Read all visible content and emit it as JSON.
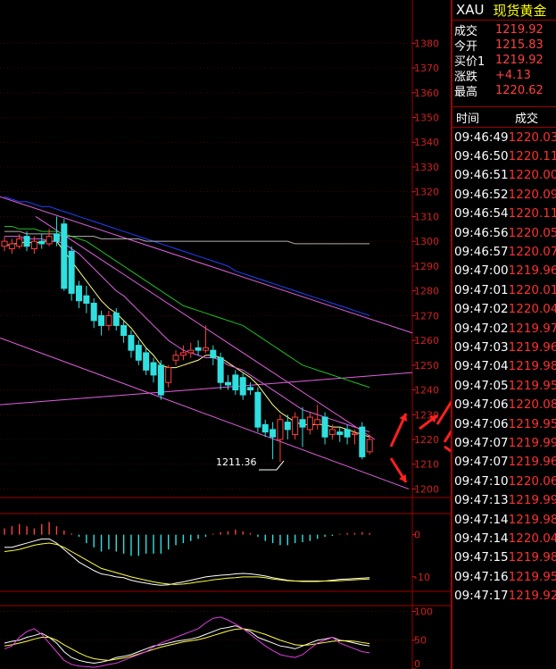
{
  "header": {
    "symbol": "XAU",
    "name": "现货黄金"
  },
  "quote": [
    {
      "label": "成交",
      "value": "1219.92"
    },
    {
      "label": "今开",
      "value": "1215.83"
    },
    {
      "label": "买价1",
      "value": "1219.92"
    },
    {
      "label": "涨跌",
      "value": "+4.13"
    },
    {
      "label": "最高",
      "value": "1220.62"
    }
  ],
  "trades_header": {
    "time": "时间",
    "price": "成交"
  },
  "trades": [
    {
      "time": "09:46:49",
      "price": "1220.03"
    },
    {
      "time": "09:46:50",
      "price": "1220.11"
    },
    {
      "time": "09:46:51",
      "price": "1220.00"
    },
    {
      "time": "09:46:52",
      "price": "1220.09"
    },
    {
      "time": "09:46:54",
      "price": "1220.11"
    },
    {
      "time": "09:46:56",
      "price": "1220.05"
    },
    {
      "time": "09:46:57",
      "price": "1220.07"
    },
    {
      "time": "09:47:00",
      "price": "1219.96"
    },
    {
      "time": "09:47:01",
      "price": "1220.01"
    },
    {
      "time": "09:47:02",
      "price": "1220.04"
    },
    {
      "time": "09:47:02",
      "price": "1219.97"
    },
    {
      "time": "09:47:03",
      "price": "1219.96"
    },
    {
      "time": "09:47:04",
      "price": "1219.98"
    },
    {
      "time": "09:47:05",
      "price": "1219.95"
    },
    {
      "time": "09:47:06",
      "price": "1220.08"
    },
    {
      "time": "09:47:06",
      "price": "1219.95"
    },
    {
      "time": "09:47:07",
      "price": "1219.99"
    },
    {
      "time": "09:47:07",
      "price": "1219.96"
    },
    {
      "time": "09:47:10",
      "price": "1220.06"
    },
    {
      "time": "09:47:13",
      "price": "1219.99"
    },
    {
      "time": "09:47:14",
      "price": "1219.98"
    },
    {
      "time": "09:47:14",
      "price": "1220.04"
    },
    {
      "time": "09:47:15",
      "price": "1219.98"
    },
    {
      "time": "09:47:16",
      "price": "1219.95"
    },
    {
      "time": "09:47:17",
      "price": "1219.92"
    }
  ],
  "chart_data": [
    {
      "type": "candlestick",
      "price_axis_ticks": [
        1380,
        1370,
        1360,
        1350,
        1340,
        1330,
        1320,
        1310,
        1300,
        1290,
        1280,
        1270,
        1260,
        1250,
        1240,
        1230,
        1220,
        1210,
        1200
      ],
      "ylim": [
        1198,
        1383
      ],
      "annotations": [
        {
          "text": "1211.36",
          "value": 1211.36
        }
      ],
      "candles": [
        {
          "o": 1298,
          "c": 1300,
          "h": 1302,
          "l": 1296
        },
        {
          "o": 1297,
          "c": 1299,
          "h": 1301,
          "l": 1295
        },
        {
          "o": 1298,
          "c": 1301,
          "h": 1303,
          "l": 1297
        },
        {
          "o": 1302,
          "c": 1298,
          "h": 1304,
          "l": 1296
        },
        {
          "o": 1297,
          "c": 1300,
          "h": 1302,
          "l": 1295
        },
        {
          "o": 1300,
          "c": 1299,
          "h": 1303,
          "l": 1297
        },
        {
          "o": 1299,
          "c": 1302,
          "h": 1305,
          "l": 1298
        },
        {
          "o": 1303,
          "c": 1300,
          "h": 1310,
          "l": 1298
        },
        {
          "o": 1307,
          "c": 1281,
          "h": 1309,
          "l": 1280
        },
        {
          "o": 1296,
          "c": 1279,
          "h": 1298,
          "l": 1276
        },
        {
          "o": 1282,
          "c": 1276,
          "h": 1284,
          "l": 1273
        },
        {
          "o": 1278,
          "c": 1275,
          "h": 1282,
          "l": 1271
        },
        {
          "o": 1275,
          "c": 1268,
          "h": 1277,
          "l": 1265
        },
        {
          "o": 1270,
          "c": 1266,
          "h": 1272,
          "l": 1262
        },
        {
          "o": 1266,
          "c": 1270,
          "h": 1272,
          "l": 1264
        },
        {
          "o": 1271,
          "c": 1266,
          "h": 1273,
          "l": 1264
        },
        {
          "o": 1266,
          "c": 1262,
          "h": 1268,
          "l": 1259
        },
        {
          "o": 1262,
          "c": 1256,
          "h": 1264,
          "l": 1253
        },
        {
          "o": 1258,
          "c": 1252,
          "h": 1260,
          "l": 1250
        },
        {
          "o": 1255,
          "c": 1248,
          "h": 1257,
          "l": 1246
        },
        {
          "o": 1251,
          "c": 1246,
          "h": 1253,
          "l": 1243
        },
        {
          "o": 1250,
          "c": 1238,
          "h": 1252,
          "l": 1236
        },
        {
          "o": 1243,
          "c": 1249,
          "h": 1250,
          "l": 1241
        },
        {
          "o": 1252,
          "c": 1254,
          "h": 1256,
          "l": 1250
        },
        {
          "o": 1254,
          "c": 1255,
          "h": 1258,
          "l": 1252
        },
        {
          "o": 1255,
          "c": 1256,
          "h": 1259,
          "l": 1253
        },
        {
          "o": 1257,
          "c": 1256,
          "h": 1260,
          "l": 1254
        },
        {
          "o": 1256,
          "c": 1257,
          "h": 1266,
          "l": 1255
        },
        {
          "o": 1256,
          "c": 1253,
          "h": 1258,
          "l": 1250
        },
        {
          "o": 1253,
          "c": 1243,
          "h": 1255,
          "l": 1240
        },
        {
          "o": 1243,
          "c": 1242,
          "h": 1246,
          "l": 1240
        },
        {
          "o": 1246,
          "c": 1240,
          "h": 1248,
          "l": 1238
        },
        {
          "o": 1245,
          "c": 1238,
          "h": 1247,
          "l": 1236
        },
        {
          "o": 1241,
          "c": 1240,
          "h": 1243,
          "l": 1238
        },
        {
          "o": 1239,
          "c": 1225,
          "h": 1241,
          "l": 1223
        },
        {
          "o": 1226,
          "c": 1223,
          "h": 1228,
          "l": 1221
        },
        {
          "o": 1224,
          "c": 1221,
          "h": 1227,
          "l": 1212
        },
        {
          "o": 1220,
          "c": 1228,
          "h": 1230,
          "l": 1211
        },
        {
          "o": 1227,
          "c": 1224,
          "h": 1230,
          "l": 1220
        },
        {
          "o": 1222,
          "c": 1229,
          "h": 1231,
          "l": 1220
        },
        {
          "o": 1228,
          "c": 1225,
          "h": 1233,
          "l": 1217
        },
        {
          "o": 1224,
          "c": 1229,
          "h": 1231,
          "l": 1222
        },
        {
          "o": 1226,
          "c": 1228,
          "h": 1234,
          "l": 1224
        },
        {
          "o": 1229,
          "c": 1221,
          "h": 1231,
          "l": 1218
        },
        {
          "o": 1222,
          "c": 1224,
          "h": 1226,
          "l": 1220
        },
        {
          "o": 1223,
          "c": 1222,
          "h": 1225,
          "l": 1219
        },
        {
          "o": 1224,
          "c": 1221,
          "h": 1226,
          "l": 1218
        },
        {
          "o": 1222,
          "c": 1222.5,
          "h": 1224,
          "l": 1218
        },
        {
          "o": 1225,
          "c": 1213,
          "h": 1227,
          "l": 1212
        },
        {
          "o": 1215,
          "c": 1220,
          "h": 1222,
          "l": 1214
        }
      ],
      "moving_averages": [
        {
          "color": "#ffff80",
          "values": [
            1298,
            1299,
            1299,
            1300,
            1299,
            1300,
            1300,
            1300,
            1296,
            1292,
            1288,
            1284,
            1280,
            1276,
            1273,
            1271,
            1268,
            1265,
            1261,
            1257,
            1254,
            1250,
            1249,
            1249,
            1250,
            1251,
            1252,
            1254,
            1254,
            1253,
            1251,
            1249,
            1247,
            1245,
            1242,
            1238,
            1234,
            1231,
            1229,
            1227,
            1226,
            1226,
            1226,
            1226,
            1225,
            1225,
            1224,
            1223,
            1222,
            1221
          ]
        },
        {
          "color": "#e060e0",
          "values": [
            1302,
            1302,
            1302,
            1301,
            1301,
            1301,
            1300,
            1300,
            1299,
            1297,
            1295,
            1292,
            1289,
            1286,
            1283,
            1280,
            1278,
            1275,
            1272,
            1269,
            1266,
            1263,
            1260,
            1258,
            1256,
            1255,
            1254,
            1253,
            1253,
            1252,
            1250,
            1249,
            1248,
            1246,
            1244,
            1242,
            1240,
            1238,
            1236,
            1234,
            1232,
            1231,
            1230,
            1229,
            1228,
            1227,
            1226,
            1225,
            1224,
            1223
          ]
        },
        {
          "color": "#20c020",
          "values": [
            1306,
            1306,
            1305,
            1305,
            1305,
            1304,
            1304,
            1304,
            1303,
            1302,
            1301,
            1300,
            1298,
            1296,
            1294,
            1292,
            1290,
            1288,
            1286,
            1284,
            1282,
            1280,
            1278,
            1276,
            1274,
            1273,
            1272,
            1271,
            1270,
            1269,
            1268,
            1267,
            1266,
            1264,
            1262,
            1260,
            1258,
            1256,
            1254,
            1252,
            1250,
            1249,
            1248,
            1247,
            1246,
            1245,
            1244,
            1243,
            1242,
            1241
          ]
        },
        {
          "color": "#2040ff",
          "values": [
            1318,
            1317,
            1316,
            1316,
            1315,
            1314,
            1314,
            1313,
            1312,
            1311,
            1310,
            1309,
            1308,
            1307,
            1306,
            1305,
            1304,
            1303,
            1302,
            1301,
            1300,
            1299,
            1298,
            1297,
            1296,
            1295,
            1294,
            1293,
            1292,
            1291,
            1290,
            1288,
            1287,
            1286,
            1285,
            1284,
            1283,
            1282,
            1281,
            1280,
            1279,
            1278,
            1277,
            1276,
            1275,
            1274,
            1273,
            1272,
            1271,
            1270
          ]
        },
        {
          "color": "#b0b0b0",
          "values": [
            1304,
            1304,
            1304,
            1303,
            1303,
            1303,
            1303,
            1303,
            1302,
            1302,
            1302,
            1302,
            1302,
            1301,
            1301,
            1301,
            1301,
            1301,
            1301,
            1300,
            1300,
            1300,
            1300,
            1300,
            1300,
            1300,
            1300,
            1300,
            1300,
            1300,
            1300,
            1300,
            1300,
            1300,
            1300,
            1300,
            1300,
            1300,
            1300,
            1299,
            1299,
            1299,
            1299,
            1299,
            1299,
            1299,
            1299,
            1299,
            1299,
            1299
          ]
        }
      ]
    },
    {
      "type": "histogram",
      "axis_ticks": [
        0,
        -10
      ],
      "ylim": [
        -13,
        5
      ],
      "bars": [
        1.5,
        2,
        2.5,
        2,
        1.5,
        2.5,
        3,
        2,
        1,
        0.3,
        -0.5,
        -2,
        -3,
        -4,
        -3.5,
        -4,
        -4.5,
        -5,
        -5,
        -4.5,
        -4.5,
        -4.5,
        -3.5,
        -2.5,
        -2,
        -1.5,
        -1,
        -0.5,
        0.2,
        0.6,
        0.8,
        1.2,
        0.8,
        0.4,
        -0.5,
        -1.5,
        -2,
        -2.5,
        -2.5,
        -2,
        -1.8,
        -1.5,
        -1,
        -0.5,
        -0.3,
        0.2,
        0.4,
        0.4,
        0.6,
        0.4
      ],
      "lines": [
        {
          "color": "#ffffff",
          "values": [
            -3,
            -3,
            -2.5,
            -2,
            -1.5,
            -1,
            -1,
            -2,
            -3.5,
            -5,
            -6.5,
            -7.5,
            -8.5,
            -9.3,
            -9.6,
            -10,
            -10.2,
            -10.8,
            -11.2,
            -11.5,
            -11.8,
            -12,
            -11.9,
            -11.5,
            -11.2,
            -10.8,
            -10.4,
            -10,
            -9.8,
            -9.6,
            -9.5,
            -9.3,
            -9.2,
            -9.3,
            -9.5,
            -9.8,
            -10.2,
            -10.5,
            -10.8,
            -11,
            -11,
            -11,
            -11,
            -11,
            -10.8,
            -10.6,
            -10.5,
            -10.4,
            -10.3,
            -10.2
          ]
        },
        {
          "color": "#ffff40",
          "values": [
            -4,
            -3.8,
            -3.5,
            -3,
            -2.5,
            -2.2,
            -2,
            -2.3,
            -3,
            -4,
            -5,
            -6,
            -7,
            -8,
            -8.5,
            -9,
            -9.5,
            -10,
            -10.4,
            -10.8,
            -11.2,
            -11.5,
            -11.7,
            -11.8,
            -11.7,
            -11.5,
            -11.2,
            -11,
            -10.7,
            -10.5,
            -10.3,
            -10.2,
            -10,
            -10,
            -10,
            -10.2,
            -10.5,
            -10.7,
            -10.9,
            -11,
            -11.1,
            -11.1,
            -11.1,
            -11,
            -11,
            -10.9,
            -10.8,
            -10.7,
            -10.6,
            -10.5
          ]
        }
      ]
    },
    {
      "type": "line",
      "axis_ticks": [
        100,
        50,
        0
      ],
      "ylim": [
        0,
        110
      ],
      "series": [
        {
          "color": "#ffffff",
          "values": [
            45,
            48,
            50,
            55,
            58,
            62,
            55,
            45,
            30,
            20,
            15,
            12,
            10,
            12,
            15,
            20,
            22,
            25,
            30,
            35,
            40,
            42,
            45,
            48,
            50,
            52,
            55,
            60,
            65,
            70,
            72,
            75,
            70,
            65,
            55,
            50,
            45,
            40,
            38,
            35,
            40,
            45,
            50,
            52,
            55,
            50,
            48,
            45,
            42,
            40
          ]
        },
        {
          "color": "#ffff40",
          "values": [
            40,
            42,
            45,
            48,
            52,
            55,
            55,
            50,
            42,
            35,
            28,
            22,
            18,
            16,
            15,
            17,
            19,
            22,
            26,
            30,
            34,
            38,
            41,
            44,
            47,
            49,
            51,
            54,
            58,
            62,
            66,
            69,
            70,
            68,
            64,
            60,
            55,
            50,
            46,
            42,
            41,
            42,
            44,
            46,
            48,
            49,
            49,
            48,
            46,
            44
          ]
        },
        {
          "color": "#e040e0",
          "values": [
            35,
            40,
            55,
            65,
            70,
            60,
            45,
            30,
            15,
            8,
            5,
            4,
            3,
            5,
            8,
            10,
            15,
            20,
            25,
            30,
            38,
            45,
            50,
            55,
            60,
            65,
            70,
            80,
            88,
            90,
            85,
            78,
            70,
            60,
            50,
            40,
            32,
            25,
            22,
            20,
            25,
            35,
            45,
            50,
            55,
            45,
            40,
            35,
            30,
            28
          ]
        }
      ]
    }
  ]
}
